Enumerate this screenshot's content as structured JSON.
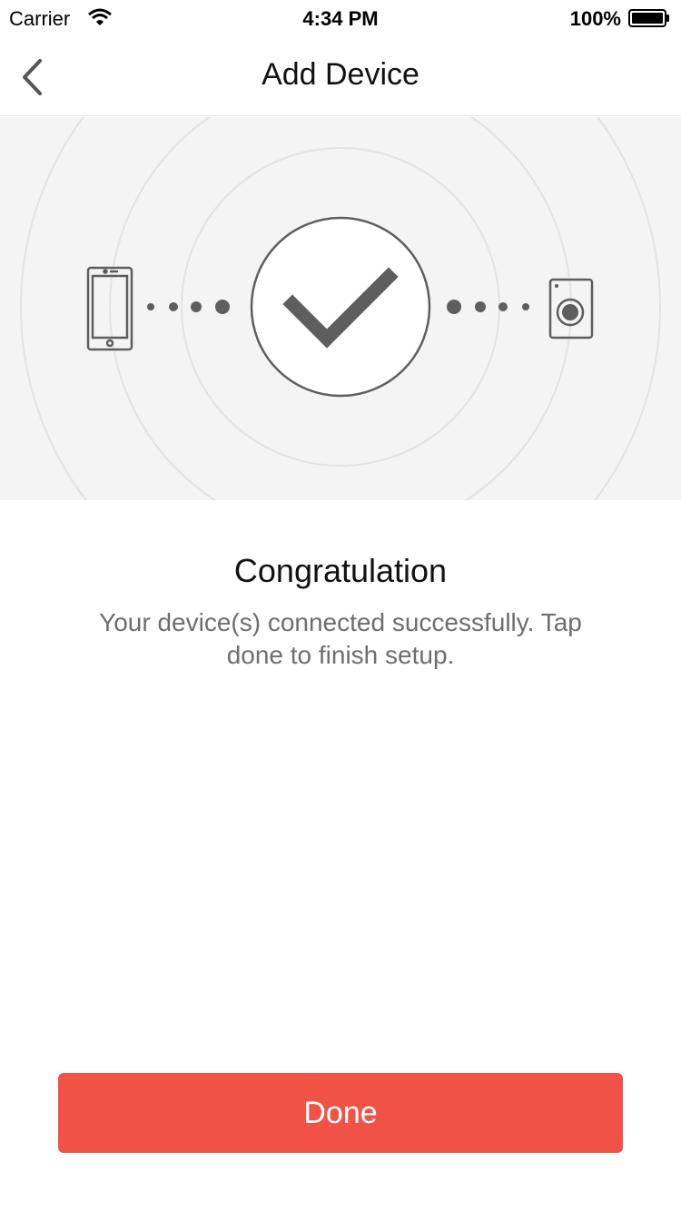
{
  "status_bar": {
    "carrier": "Carrier",
    "time": "4:34 PM",
    "battery_percent": "100%"
  },
  "nav": {
    "title": "Add Device",
    "back_icon": "chevron-left-icon"
  },
  "illustration": {
    "left_device_icon": "smartphone-icon",
    "center_icon": "checkmark-icon",
    "right_device_icon": "washing-machine-icon"
  },
  "message": {
    "title": "Congratulation",
    "body": "Your device(s) connected successfully. Tap done to finish setup."
  },
  "actions": {
    "done_label": "Done"
  },
  "colors": {
    "accent": "#f05246",
    "hero_bg": "#f4f4f5",
    "icon_gray": "#5e5e5e"
  }
}
